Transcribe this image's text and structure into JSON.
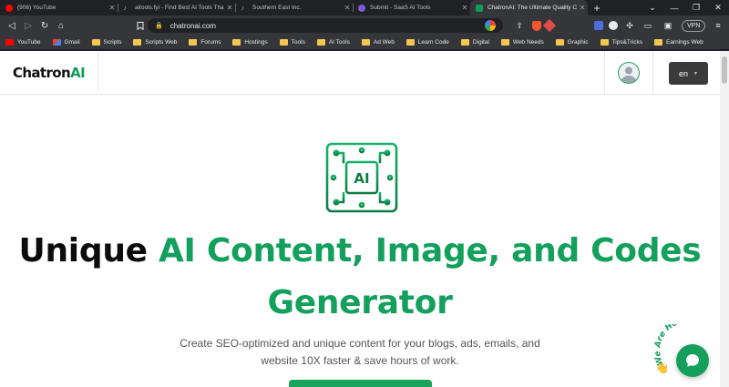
{
  "browser": {
    "tabs": [
      {
        "title": "(906) YouTube",
        "favicon_color": "#ff0000",
        "active": false
      },
      {
        "title": "aitools.fyi - Find Best AI Tools That Ma",
        "favicon_color": "#8a8a8a",
        "active": false
      },
      {
        "title": "Southern East Inc.",
        "favicon_color": "#8a8a8a",
        "active": false
      },
      {
        "title": "Submit - SaaS AI Tools",
        "favicon_color": "#7b5cd6",
        "active": false
      },
      {
        "title": "ChatronAI: The Ultimate Quality C",
        "favicon_color": "#0f9d58",
        "active": true
      }
    ],
    "new_tab_icon": "plus-icon",
    "window_controls": [
      "chevron-down-icon",
      "minimize-icon",
      "restore-icon",
      "close-icon"
    ],
    "address_bar": {
      "url": "chatronai.com"
    },
    "extensions": {
      "vpn_label": "VPN",
      "brave_badge": "0",
      "notification_badge": "1"
    },
    "bookmarks": [
      {
        "label": "YouTube",
        "icon": "youtube-icon"
      },
      {
        "label": "Gmail",
        "icon": "gmail-icon"
      },
      {
        "label": "Scripts",
        "icon": "folder-icon"
      },
      {
        "label": "Scripts Web",
        "icon": "folder-icon"
      },
      {
        "label": "Forums",
        "icon": "folder-icon"
      },
      {
        "label": "Hostings",
        "icon": "folder-icon"
      },
      {
        "label": "Tools",
        "icon": "folder-icon"
      },
      {
        "label": "AI Tools",
        "icon": "folder-icon"
      },
      {
        "label": "Ad Web",
        "icon": "folder-icon"
      },
      {
        "label": "Learn Code",
        "icon": "folder-icon"
      },
      {
        "label": "Digital",
        "icon": "folder-icon"
      },
      {
        "label": "Web Needs",
        "icon": "folder-icon"
      },
      {
        "label": "Graphic",
        "icon": "folder-icon"
      },
      {
        "label": "Tips&Tricks",
        "icon": "folder-icon"
      },
      {
        "label": "Earnings Web",
        "icon": "folder-icon"
      }
    ]
  },
  "site": {
    "logo": {
      "part1": "Chatron",
      "part2": "AI"
    },
    "language": {
      "selected": "en"
    },
    "hero": {
      "chip_label": "AI",
      "headline_dark": "Unique ",
      "headline_green_1": "AI Content, Image, and Codes",
      "headline_green_2": "Generator",
      "subtitle": "Create SEO-optimized and unique content for your blogs, ads, emails, and website 10X faster & save hours of work."
    },
    "chat_widget": {
      "badge_text": "We Are Here!",
      "icon": "chat-bubble-icon"
    }
  },
  "colors": {
    "brand_green": "#13a05c",
    "dark_text": "#0c0c0c",
    "chrome_dark": "#202124",
    "chrome_toolbar": "#35363a"
  }
}
